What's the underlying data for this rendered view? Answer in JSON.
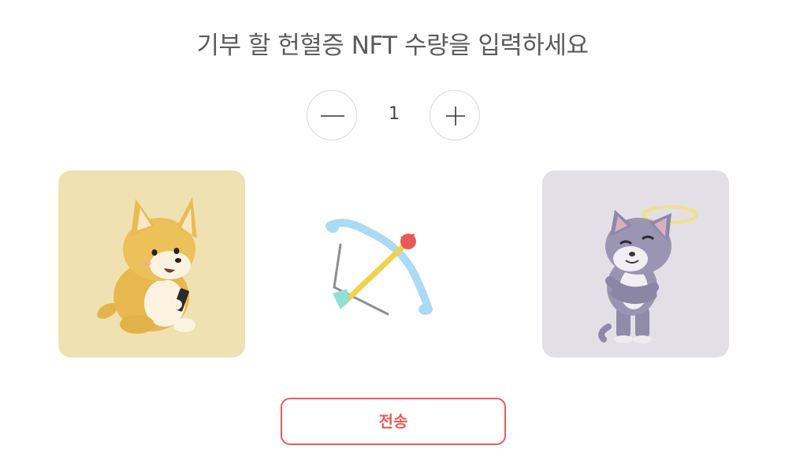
{
  "heading": "기부 할 헌혈증 NFT 수량을 입력하세요",
  "stepper": {
    "decrement_icon": "minus-icon",
    "value": "1",
    "increment_icon": "plus-icon"
  },
  "cards": {
    "sender_image": "shiba-dog-with-phone-illustration",
    "transfer_icon": "bow-and-arrow-icon",
    "recipient_image": "angel-cat-with-halo-illustration"
  },
  "submit": {
    "label": "전송"
  },
  "colors": {
    "accent": "#ee5a5a",
    "sender_card_bg": "#f0e1b2",
    "recipient_card_bg": "#e2e0e6",
    "title_text": "#5b5b5b"
  }
}
